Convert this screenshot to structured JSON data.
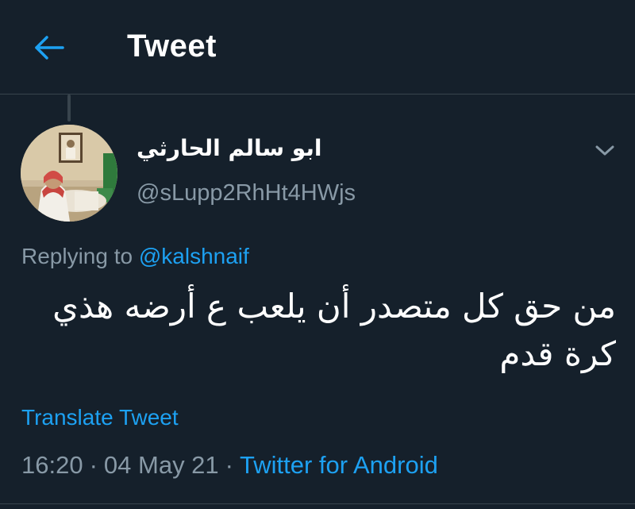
{
  "header": {
    "back_icon": "arrow-left-icon",
    "title": "Tweet"
  },
  "colors": {
    "background": "#15202b",
    "accent": "#1da1f2",
    "secondary_text": "#8899a6",
    "divider": "#38444d"
  },
  "author": {
    "display_name": "ابو سالم الحارثي",
    "handle": "@sLupp2RhHt4HWjs",
    "menu_icon": "chevron-down-icon"
  },
  "reply": {
    "prefix": "Replying to",
    "mention": "@kalshnaif"
  },
  "tweet": {
    "text": "من حق كل متصدر أن يلعب ع أرضه هذي كرة قدم",
    "translate_label": "Translate Tweet",
    "time": "16:20",
    "separator": "·",
    "date": "04 May 21",
    "source": "Twitter for Android"
  }
}
